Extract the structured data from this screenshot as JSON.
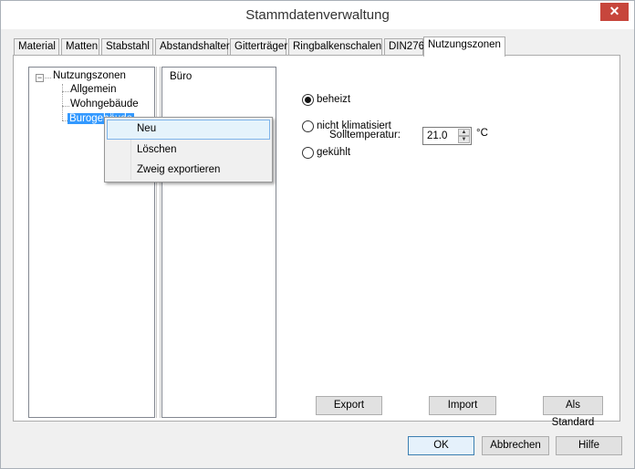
{
  "window": {
    "title": "Stammdatenverwaltung",
    "close_glyph": "✕"
  },
  "tabs": [
    {
      "label": "Material"
    },
    {
      "label": "Matten"
    },
    {
      "label": "Stabstahl"
    },
    {
      "label": "Abstandshalter"
    },
    {
      "label": "Gitterträger"
    },
    {
      "label": "Ringbalkenschalen"
    },
    {
      "label": "DIN276"
    },
    {
      "label": "Nutzungszonen",
      "active": true
    }
  ],
  "tree": {
    "root": "Nutzungszonen",
    "expander_glyph": "−",
    "children": [
      "Allgemein",
      "Wohngebäude",
      "Burogebäude"
    ]
  },
  "list": {
    "items": [
      "Büro"
    ]
  },
  "options": {
    "radios": [
      {
        "label": "beheizt",
        "checked": true
      },
      {
        "label": "nicht klimatisiert",
        "checked": false
      },
      {
        "label": "gekühlt",
        "checked": false
      }
    ],
    "temperature_label": "Solltemperatur:",
    "temperature_value": "21.0",
    "temperature_unit": "°C"
  },
  "tab_buttons": {
    "export": "Export",
    "import": "Import",
    "default": "Als Standard"
  },
  "dialog_buttons": {
    "ok": "OK",
    "cancel": "Abbrechen",
    "help": "Hilfe"
  },
  "context_menu": {
    "items": [
      "Neu",
      "Löschen",
      "Zweig exportieren"
    ],
    "hovered_index": 0
  }
}
